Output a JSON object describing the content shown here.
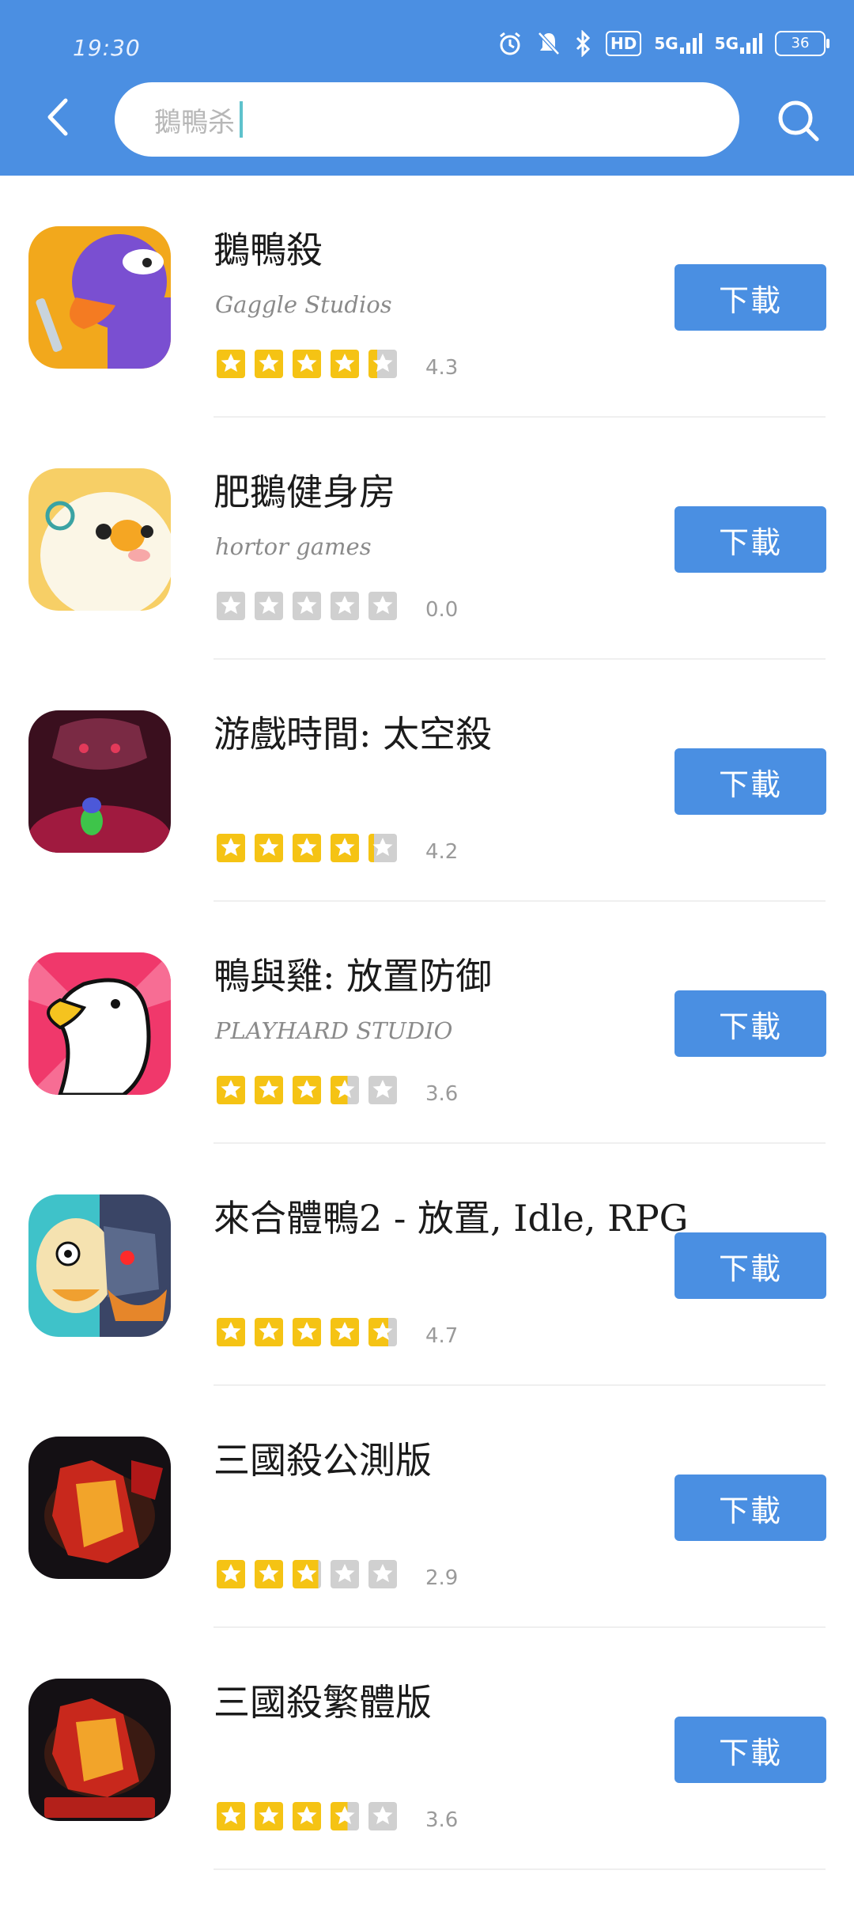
{
  "status_bar": {
    "time": "19:30",
    "hd_label": "HD",
    "net1": "5G",
    "net2": "5G",
    "battery": "36"
  },
  "search": {
    "query_text": "鵝鴨杀",
    "back_icon": "chevron-left-icon",
    "search_icon": "search-icon"
  },
  "colors": {
    "header_bg": "#4b8fe2",
    "button_bg": "#4a8fe2",
    "star_on": "#f5c314",
    "star_off": "#d0d0d0"
  },
  "download_label": "下載",
  "apps": [
    {
      "title": "鵝鴨殺",
      "developer": "Gaggle Studios",
      "stars": 4.3,
      "rating": "4.3"
    },
    {
      "title": "肥鵝健身房",
      "developer": "hortor games",
      "stars": 0,
      "rating": "0.0"
    },
    {
      "title": "游戲時間: 太空殺",
      "developer": "",
      "stars": 4.2,
      "rating": "4.2"
    },
    {
      "title": "鴨與雞: 放置防御",
      "developer": "PLAYHARD STUDIO",
      "stars": 3.6,
      "rating": "3.6"
    },
    {
      "title": "來合體鴨2 - 放置, Idle, RPG",
      "developer": "",
      "stars": 4.7,
      "rating": "4.7"
    },
    {
      "title": "三國殺公測版",
      "developer": "",
      "stars": 2.9,
      "rating": "2.9"
    },
    {
      "title": "三國殺繁體版",
      "developer": "",
      "stars": 3.6,
      "rating": "3.6"
    }
  ]
}
